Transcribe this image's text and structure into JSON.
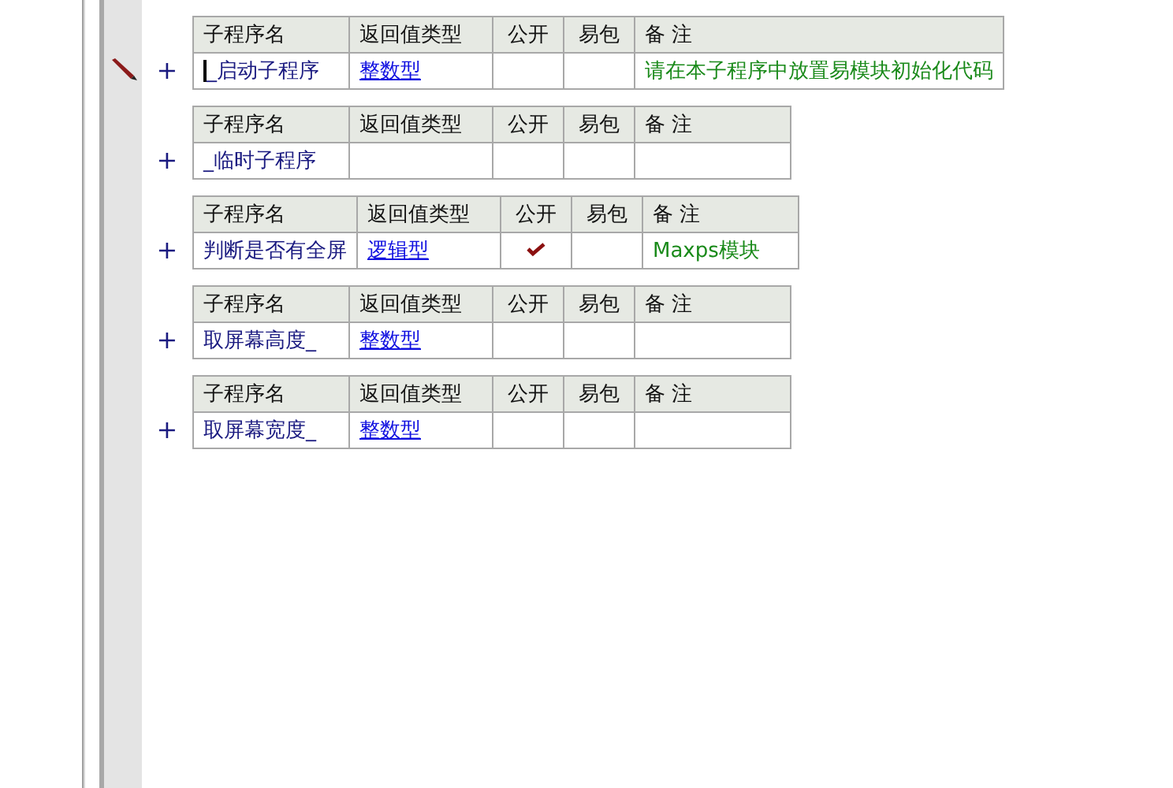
{
  "subroutines": [
    {
      "columns": [
        "子程序名",
        "返回值类型",
        "公开",
        "易包",
        "备 注"
      ],
      "expand": "+",
      "current": true,
      "name": "_启动子程序",
      "return_type": "整数型",
      "public": false,
      "easy_package": false,
      "remark": "请在本子程序中放置易模块初始化代码"
    },
    {
      "columns": [
        "子程序名",
        "返回值类型",
        "公开",
        "易包",
        "备 注"
      ],
      "expand": "+",
      "current": false,
      "name": "_临时子程序",
      "public": false,
      "easy_package": false
    },
    {
      "columns": [
        "子程序名",
        "返回值类型",
        "公开",
        "易包",
        "备 注"
      ],
      "expand": "+",
      "current": false,
      "name": "判断是否有全屏",
      "return_type": "逻辑型",
      "public": true,
      "easy_package": false,
      "remark": "Maxps模块"
    },
    {
      "columns": [
        "子程序名",
        "返回值类型",
        "公开",
        "易包",
        "备 注"
      ],
      "expand": "+",
      "current": false,
      "name": "取屏幕高度_",
      "return_type": "整数型",
      "public": false,
      "easy_package": false
    },
    {
      "columns": [
        "子程序名",
        "返回值类型",
        "公开",
        "易包",
        "备 注"
      ],
      "expand": "+",
      "current": false,
      "name": "取屏幕宽度_",
      "return_type": "整数型",
      "public": false,
      "easy_package": false
    }
  ]
}
